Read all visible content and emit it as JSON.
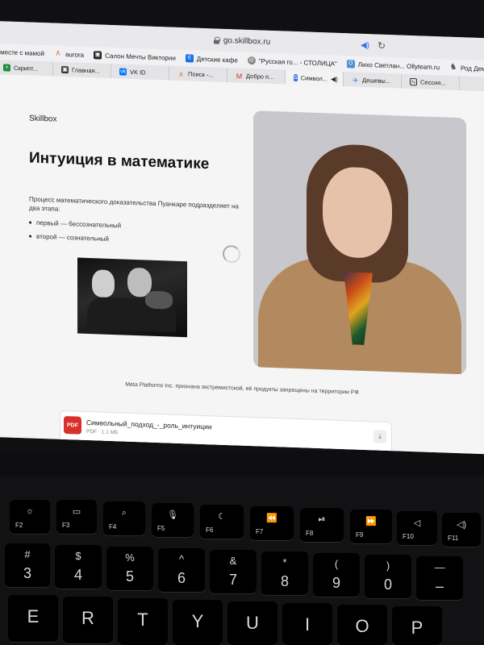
{
  "browser": {
    "url": "go.skillbox.ru",
    "bookmarks": [
      {
        "label": "вместе с мамой",
        "icon": "none"
      },
      {
        "label": "aurora",
        "icon": "aurora-icon",
        "color": "#e8762b"
      },
      {
        "label": "Салон Мечты Виктории",
        "icon": "salon-icon",
        "color": "#222222"
      },
      {
        "label": "Детские кафе",
        "icon": "cafe-icon",
        "color": "#1a73e8"
      },
      {
        "label": "\"Русская го... - СТОЛИЦА\"",
        "icon": "globe-icon",
        "color": "#777777"
      },
      {
        "label": "Лихо Светлан... Ollyteam.ru",
        "icon": "olly-icon",
        "color": "#4a90d9"
      },
      {
        "label": "Род Демидо...ВЕК АВРОРЫ",
        "icon": "person-icon",
        "color": "#555555"
      }
    ],
    "tabs": [
      {
        "label": "Скрипт...",
        "color": "#1e8e3e",
        "active": false
      },
      {
        "label": "Главная...",
        "color": "#333333",
        "active": false
      },
      {
        "label": "VK ID",
        "color": "#0077ff",
        "active": false
      },
      {
        "label": "Поиск -...",
        "color": "#e8762b",
        "active": false
      },
      {
        "label": "Добро п...",
        "color": "#d93025",
        "active": false
      },
      {
        "label": "Символ...",
        "color": "#3a6ff0",
        "active": true
      },
      {
        "label": "Дешевы...",
        "color": "#4a90d9",
        "active": false
      },
      {
        "label": "Сессия...",
        "color": "#222222",
        "active": false
      }
    ]
  },
  "page": {
    "brand": "Skillbox",
    "title": "Интуиция в математике",
    "intro": "Процесс математического доказательства Пуанкаре подразделяет на два этапа:",
    "bullets": [
      "первый — бессознательный",
      "второй — сознательный"
    ],
    "note": "Meta Platforms Inc. признана экстремистской, её продукты запрещены на территории РФ",
    "file": {
      "icon_label": "PDF",
      "name": "Символьный_подход_-_роль_интуиции",
      "meta": "PDF · 1.1 МБ"
    }
  },
  "keyboard": {
    "function_row": [
      {
        "label": "F2",
        "icon": "brightness-up-icon",
        "glyph": "☼"
      },
      {
        "label": "F3",
        "icon": "mission-control-icon",
        "glyph": "▭"
      },
      {
        "label": "F4",
        "icon": "search-icon",
        "glyph": "⌕"
      },
      {
        "label": "F5",
        "icon": "microphone-icon",
        "glyph": "🎙"
      },
      {
        "label": "F6",
        "icon": "moon-icon",
        "glyph": "☾"
      },
      {
        "label": "F7",
        "icon": "rewind-icon",
        "glyph": "⏪"
      },
      {
        "label": "F8",
        "icon": "play-pause-icon",
        "glyph": "⏯"
      },
      {
        "label": "F9",
        "icon": "fast-forward-icon",
        "glyph": "⏩"
      },
      {
        "label": "F10",
        "icon": "mute-icon",
        "glyph": "◁"
      },
      {
        "label": "F11",
        "icon": "volume-down-icon",
        "glyph": "◁)"
      }
    ],
    "number_row": [
      {
        "top": "#",
        "bottom": "3"
      },
      {
        "top": "$",
        "bottom": "4"
      },
      {
        "top": "%",
        "bottom": "5"
      },
      {
        "top": "^",
        "bottom": "6"
      },
      {
        "top": "&",
        "bottom": "7"
      },
      {
        "top": "*",
        "bottom": "8"
      },
      {
        "top": "(",
        "bottom": "9"
      },
      {
        "top": ")",
        "bottom": "0"
      },
      {
        "top": "—",
        "bottom": "–"
      }
    ],
    "letter_row": [
      "E",
      "R",
      "T",
      "Y",
      "U",
      "I",
      "O",
      "P"
    ]
  }
}
